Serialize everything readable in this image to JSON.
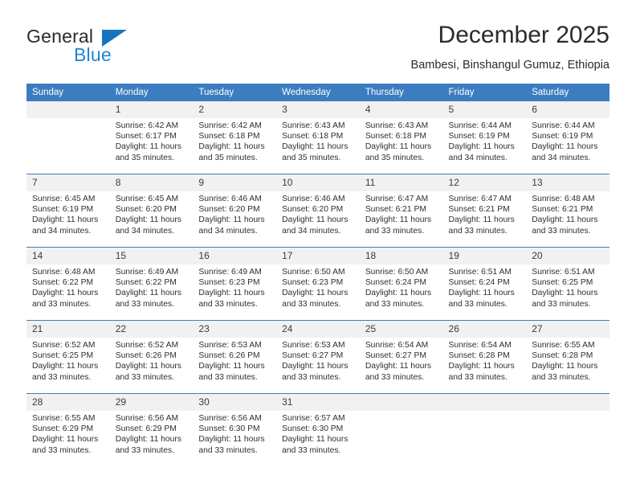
{
  "brand": {
    "name_part1": "General",
    "name_part2": "Blue",
    "triangle_color": "#1574bd",
    "blue_color": "#1f86d0"
  },
  "header": {
    "title": "December 2025",
    "subtitle": "Bambesi, Binshangul Gumuz, Ethiopia",
    "header_bg": "#3b7dc0",
    "daynum_bg": "#f1f1f1"
  },
  "weekday_headers": [
    "Sunday",
    "Monday",
    "Tuesday",
    "Wednesday",
    "Thursday",
    "Friday",
    "Saturday"
  ],
  "labels": {
    "sunrise_prefix": "Sunrise:",
    "sunset_prefix": "Sunset:",
    "daylight_prefix": "Daylight:"
  },
  "weeks": [
    [
      {
        "day": "",
        "sunrise": "",
        "sunset": "",
        "daylight_line1": "",
        "daylight_line2": "",
        "empty": true
      },
      {
        "day": "1",
        "sunrise": "Sunrise: 6:42 AM",
        "sunset": "Sunset: 6:17 PM",
        "daylight_line1": "Daylight: 11 hours",
        "daylight_line2": "and 35 minutes."
      },
      {
        "day": "2",
        "sunrise": "Sunrise: 6:42 AM",
        "sunset": "Sunset: 6:18 PM",
        "daylight_line1": "Daylight: 11 hours",
        "daylight_line2": "and 35 minutes."
      },
      {
        "day": "3",
        "sunrise": "Sunrise: 6:43 AM",
        "sunset": "Sunset: 6:18 PM",
        "daylight_line1": "Daylight: 11 hours",
        "daylight_line2": "and 35 minutes."
      },
      {
        "day": "4",
        "sunrise": "Sunrise: 6:43 AM",
        "sunset": "Sunset: 6:18 PM",
        "daylight_line1": "Daylight: 11 hours",
        "daylight_line2": "and 35 minutes."
      },
      {
        "day": "5",
        "sunrise": "Sunrise: 6:44 AM",
        "sunset": "Sunset: 6:19 PM",
        "daylight_line1": "Daylight: 11 hours",
        "daylight_line2": "and 34 minutes."
      },
      {
        "day": "6",
        "sunrise": "Sunrise: 6:44 AM",
        "sunset": "Sunset: 6:19 PM",
        "daylight_line1": "Daylight: 11 hours",
        "daylight_line2": "and 34 minutes."
      }
    ],
    [
      {
        "day": "7",
        "sunrise": "Sunrise: 6:45 AM",
        "sunset": "Sunset: 6:19 PM",
        "daylight_line1": "Daylight: 11 hours",
        "daylight_line2": "and 34 minutes."
      },
      {
        "day": "8",
        "sunrise": "Sunrise: 6:45 AM",
        "sunset": "Sunset: 6:20 PM",
        "daylight_line1": "Daylight: 11 hours",
        "daylight_line2": "and 34 minutes."
      },
      {
        "day": "9",
        "sunrise": "Sunrise: 6:46 AM",
        "sunset": "Sunset: 6:20 PM",
        "daylight_line1": "Daylight: 11 hours",
        "daylight_line2": "and 34 minutes."
      },
      {
        "day": "10",
        "sunrise": "Sunrise: 6:46 AM",
        "sunset": "Sunset: 6:20 PM",
        "daylight_line1": "Daylight: 11 hours",
        "daylight_line2": "and 34 minutes."
      },
      {
        "day": "11",
        "sunrise": "Sunrise: 6:47 AM",
        "sunset": "Sunset: 6:21 PM",
        "daylight_line1": "Daylight: 11 hours",
        "daylight_line2": "and 33 minutes."
      },
      {
        "day": "12",
        "sunrise": "Sunrise: 6:47 AM",
        "sunset": "Sunset: 6:21 PM",
        "daylight_line1": "Daylight: 11 hours",
        "daylight_line2": "and 33 minutes."
      },
      {
        "day": "13",
        "sunrise": "Sunrise: 6:48 AM",
        "sunset": "Sunset: 6:21 PM",
        "daylight_line1": "Daylight: 11 hours",
        "daylight_line2": "and 33 minutes."
      }
    ],
    [
      {
        "day": "14",
        "sunrise": "Sunrise: 6:48 AM",
        "sunset": "Sunset: 6:22 PM",
        "daylight_line1": "Daylight: 11 hours",
        "daylight_line2": "and 33 minutes."
      },
      {
        "day": "15",
        "sunrise": "Sunrise: 6:49 AM",
        "sunset": "Sunset: 6:22 PM",
        "daylight_line1": "Daylight: 11 hours",
        "daylight_line2": "and 33 minutes."
      },
      {
        "day": "16",
        "sunrise": "Sunrise: 6:49 AM",
        "sunset": "Sunset: 6:23 PM",
        "daylight_line1": "Daylight: 11 hours",
        "daylight_line2": "and 33 minutes."
      },
      {
        "day": "17",
        "sunrise": "Sunrise: 6:50 AM",
        "sunset": "Sunset: 6:23 PM",
        "daylight_line1": "Daylight: 11 hours",
        "daylight_line2": "and 33 minutes."
      },
      {
        "day": "18",
        "sunrise": "Sunrise: 6:50 AM",
        "sunset": "Sunset: 6:24 PM",
        "daylight_line1": "Daylight: 11 hours",
        "daylight_line2": "and 33 minutes."
      },
      {
        "day": "19",
        "sunrise": "Sunrise: 6:51 AM",
        "sunset": "Sunset: 6:24 PM",
        "daylight_line1": "Daylight: 11 hours",
        "daylight_line2": "and 33 minutes."
      },
      {
        "day": "20",
        "sunrise": "Sunrise: 6:51 AM",
        "sunset": "Sunset: 6:25 PM",
        "daylight_line1": "Daylight: 11 hours",
        "daylight_line2": "and 33 minutes."
      }
    ],
    [
      {
        "day": "21",
        "sunrise": "Sunrise: 6:52 AM",
        "sunset": "Sunset: 6:25 PM",
        "daylight_line1": "Daylight: 11 hours",
        "daylight_line2": "and 33 minutes."
      },
      {
        "day": "22",
        "sunrise": "Sunrise: 6:52 AM",
        "sunset": "Sunset: 6:26 PM",
        "daylight_line1": "Daylight: 11 hours",
        "daylight_line2": "and 33 minutes."
      },
      {
        "day": "23",
        "sunrise": "Sunrise: 6:53 AM",
        "sunset": "Sunset: 6:26 PM",
        "daylight_line1": "Daylight: 11 hours",
        "daylight_line2": "and 33 minutes."
      },
      {
        "day": "24",
        "sunrise": "Sunrise: 6:53 AM",
        "sunset": "Sunset: 6:27 PM",
        "daylight_line1": "Daylight: 11 hours",
        "daylight_line2": "and 33 minutes."
      },
      {
        "day": "25",
        "sunrise": "Sunrise: 6:54 AM",
        "sunset": "Sunset: 6:27 PM",
        "daylight_line1": "Daylight: 11 hours",
        "daylight_line2": "and 33 minutes."
      },
      {
        "day": "26",
        "sunrise": "Sunrise: 6:54 AM",
        "sunset": "Sunset: 6:28 PM",
        "daylight_line1": "Daylight: 11 hours",
        "daylight_line2": "and 33 minutes."
      },
      {
        "day": "27",
        "sunrise": "Sunrise: 6:55 AM",
        "sunset": "Sunset: 6:28 PM",
        "daylight_line1": "Daylight: 11 hours",
        "daylight_line2": "and 33 minutes."
      }
    ],
    [
      {
        "day": "28",
        "sunrise": "Sunrise: 6:55 AM",
        "sunset": "Sunset: 6:29 PM",
        "daylight_line1": "Daylight: 11 hours",
        "daylight_line2": "and 33 minutes."
      },
      {
        "day": "29",
        "sunrise": "Sunrise: 6:56 AM",
        "sunset": "Sunset: 6:29 PM",
        "daylight_line1": "Daylight: 11 hours",
        "daylight_line2": "and 33 minutes."
      },
      {
        "day": "30",
        "sunrise": "Sunrise: 6:56 AM",
        "sunset": "Sunset: 6:30 PM",
        "daylight_line1": "Daylight: 11 hours",
        "daylight_line2": "and 33 minutes."
      },
      {
        "day": "31",
        "sunrise": "Sunrise: 6:57 AM",
        "sunset": "Sunset: 6:30 PM",
        "daylight_line1": "Daylight: 11 hours",
        "daylight_line2": "and 33 minutes."
      },
      {
        "day": "",
        "sunrise": "",
        "sunset": "",
        "daylight_line1": "",
        "daylight_line2": "",
        "empty": true
      },
      {
        "day": "",
        "sunrise": "",
        "sunset": "",
        "daylight_line1": "",
        "daylight_line2": "",
        "empty": true
      },
      {
        "day": "",
        "sunrise": "",
        "sunset": "",
        "daylight_line1": "",
        "daylight_line2": "",
        "empty": true
      }
    ]
  ]
}
